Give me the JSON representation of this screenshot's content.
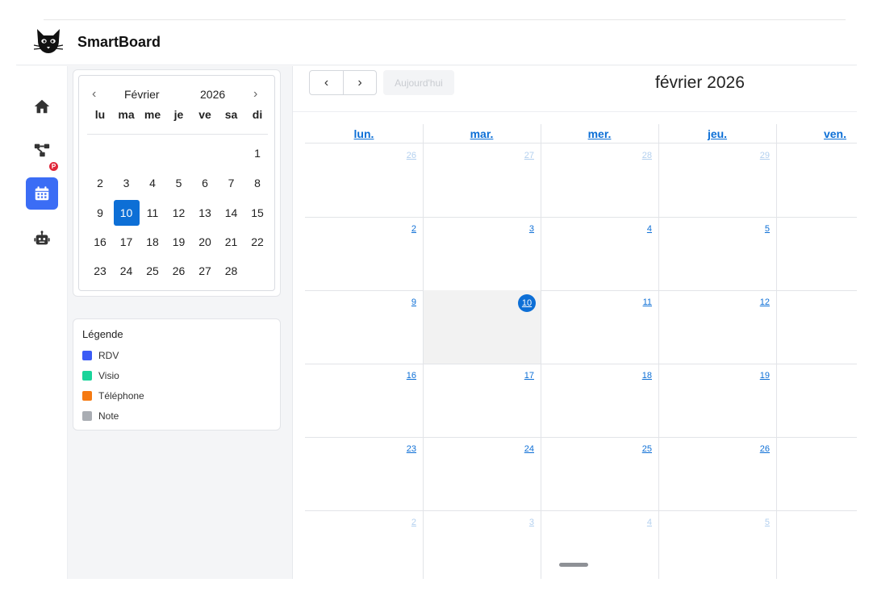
{
  "app": {
    "title": "SmartBoard"
  },
  "nav": {
    "items": [
      {
        "name": "home",
        "icon": "home-icon",
        "active": false
      },
      {
        "name": "workflow",
        "icon": "flow-icon",
        "active": false,
        "badge": "P"
      },
      {
        "name": "calendar",
        "icon": "calendar-icon",
        "active": true
      },
      {
        "name": "assistant",
        "icon": "robot-icon",
        "active": false
      }
    ],
    "accent": "#3b6df5",
    "badge_color": "#e0273a"
  },
  "mini_calendar": {
    "month": "Février",
    "year": "2026",
    "prev": "‹",
    "next": "›",
    "weekdays": [
      "lu",
      "ma",
      "me",
      "je",
      "ve",
      "sa",
      "di"
    ],
    "weeks": [
      [
        "",
        "",
        "",
        "",
        "",
        "",
        "1"
      ],
      [
        "2",
        "3",
        "4",
        "5",
        "6",
        "7",
        "8"
      ],
      [
        "9",
        "10",
        "11",
        "12",
        "13",
        "14",
        "15"
      ],
      [
        "16",
        "17",
        "18",
        "19",
        "20",
        "21",
        "22"
      ],
      [
        "23",
        "24",
        "25",
        "26",
        "27",
        "28",
        ""
      ]
    ],
    "selected": "10",
    "selected_color": "#0d6fd6"
  },
  "legend": {
    "title": "Légende",
    "items": [
      {
        "label": "RDV",
        "color": "#3b5bf5"
      },
      {
        "label": "Visio",
        "color": "#19d49a"
      },
      {
        "label": "Téléphone",
        "color": "#f57a12"
      },
      {
        "label": "Note",
        "color": "#a9adb3"
      }
    ]
  },
  "toolbar": {
    "prev": "‹",
    "next": "›",
    "today": "Aujourd'hui",
    "title": "février 2026"
  },
  "calendar": {
    "weekdays": [
      "lun.",
      "mar.",
      "mer.",
      "jeu.",
      "ven."
    ],
    "weeks": [
      [
        {
          "d": "26",
          "muted": true
        },
        {
          "d": "27",
          "muted": true
        },
        {
          "d": "28",
          "muted": true
        },
        {
          "d": "29",
          "muted": true
        },
        {
          "d": "",
          "muted": true
        }
      ],
      [
        {
          "d": "2"
        },
        {
          "d": "3"
        },
        {
          "d": "4"
        },
        {
          "d": "5"
        },
        {
          "d": ""
        }
      ],
      [
        {
          "d": "9"
        },
        {
          "d": "10",
          "today": true
        },
        {
          "d": "11"
        },
        {
          "d": "12"
        },
        {
          "d": ""
        }
      ],
      [
        {
          "d": "16"
        },
        {
          "d": "17"
        },
        {
          "d": "18"
        },
        {
          "d": "19"
        },
        {
          "d": ""
        }
      ],
      [
        {
          "d": "23"
        },
        {
          "d": "24"
        },
        {
          "d": "25"
        },
        {
          "d": "26"
        },
        {
          "d": ""
        }
      ],
      [
        {
          "d": "2",
          "muted": true
        },
        {
          "d": "3",
          "muted": true
        },
        {
          "d": "4",
          "muted": true
        },
        {
          "d": "5",
          "muted": true
        },
        {
          "d": "",
          "muted": true
        }
      ]
    ],
    "link_color": "#0d6fd6"
  }
}
